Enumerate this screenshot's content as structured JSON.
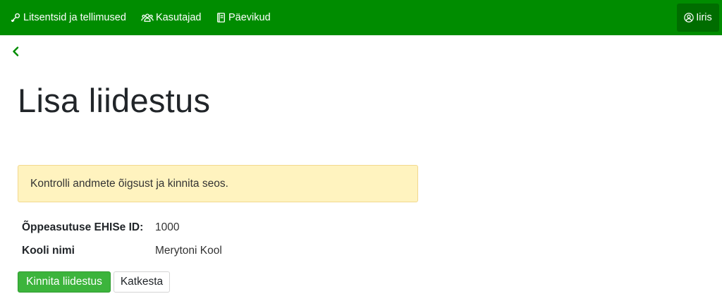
{
  "navbar": {
    "items": [
      {
        "label": "Litsentsid ja tellimused",
        "icon": "key-icon"
      },
      {
        "label": "Kasutajad",
        "icon": "users-icon"
      },
      {
        "label": "Päevikud",
        "icon": "book-icon"
      }
    ],
    "user": {
      "label": "Iiris",
      "icon": "user-circle-icon"
    }
  },
  "back": {
    "icon": "chevron-left-icon"
  },
  "page": {
    "title": "Lisa liidestus"
  },
  "alert": {
    "text": "Kontrolli andmete õigsust ja kinnita seos."
  },
  "details": [
    {
      "label": "Õppeasutuse EHISe ID:",
      "value": "1000"
    },
    {
      "label": "Kooli nimi",
      "value": "Merytoni Kool"
    }
  ],
  "actions": {
    "confirm_label": "Kinnita liidestus",
    "cancel_label": "Katkesta"
  },
  "colors": {
    "navbar": "#008c00",
    "user_menu": "#006d00",
    "alert_bg": "#fff3bf",
    "primary_button": "#3cb43c",
    "back_chevron": "#008c00"
  }
}
